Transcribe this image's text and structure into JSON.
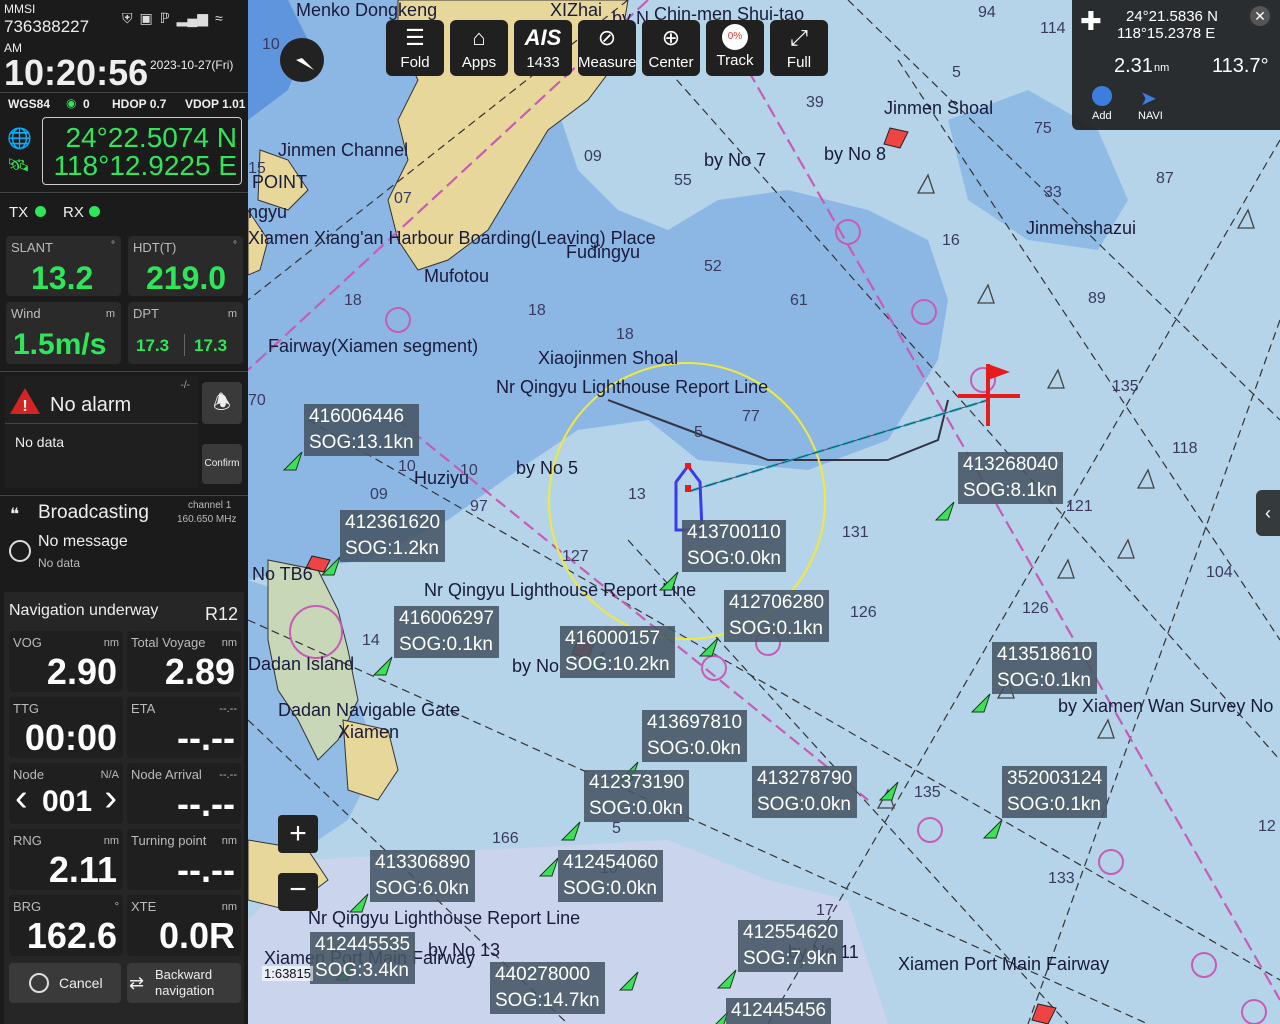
{
  "status": {
    "mmsi_label": "MMSI",
    "mmsi": "736388227",
    "ampm": "AM",
    "time": "10:20:56",
    "date": "2023-10-27(Fri)"
  },
  "gps": {
    "datum": "WGS84",
    "sats": "0",
    "hdop": "HDOP 0.7",
    "vdop": "VDOP 1.01",
    "lat": "24°22.5074 N",
    "lon": "118°12.9225 E"
  },
  "txrx": {
    "tx": "TX",
    "rx": "RX"
  },
  "gauges": [
    {
      "label": "SLANT",
      "unit": "°",
      "value": "13.2"
    },
    {
      "label": "HDT(T)",
      "unit": "°",
      "value": "219.0"
    },
    {
      "label": "Wind",
      "unit": "m",
      "value": "1.5m/s"
    },
    {
      "label": "DPT",
      "unit": "m",
      "value_a": "17.3",
      "value_b": "17.3"
    }
  ],
  "alarm": {
    "title": "No alarm",
    "flag": "-/-",
    "body": "No data",
    "confirm": "Confirm"
  },
  "broadcast": {
    "title": "Broadcasting",
    "channel": "channel 1",
    "freq": "160.650 MHz",
    "msg_title": "No message",
    "msg_body": "No data"
  },
  "nav": {
    "title": "Navigation underway",
    "route": "R12",
    "cells": [
      {
        "label": "VOG",
        "unit": "nm",
        "value": "2.90"
      },
      {
        "label": "Total Voyage",
        "unit": "nm",
        "value": "2.89"
      },
      {
        "label": "TTG",
        "unit": "",
        "value": "00:00"
      },
      {
        "label": "ETA",
        "unit": "--.--",
        "value": "--.--"
      },
      {
        "label": "Node",
        "unit": "N/A",
        "value": "001"
      },
      {
        "label": "Node Arrival",
        "unit": "--.--",
        "value": "--.--"
      },
      {
        "label": "RNG",
        "unit": "nm",
        "value": "2.11"
      },
      {
        "label": "Turning point",
        "unit": "nm",
        "value": "--.--"
      },
      {
        "label": "BRG",
        "unit": "°",
        "value": "162.6"
      },
      {
        "label": "XTE",
        "unit": "nm",
        "value": "0.0R"
      }
    ],
    "cancel": "Cancel",
    "backward": "Backward navigation"
  },
  "toolbar": [
    {
      "label": "Fold",
      "icon": "fold-icon"
    },
    {
      "label": "Apps",
      "icon": "home-icon"
    },
    {
      "label": "1433",
      "icon": "ais-icon",
      "icon_text": "AIS"
    },
    {
      "label": "Measure",
      "icon": "ruler-icon"
    },
    {
      "label": "Center",
      "icon": "crosshair-icon"
    },
    {
      "label": "Track",
      "icon": "track-icon",
      "icon_text": "0%"
    },
    {
      "label": "Full",
      "icon": "fullscreen-icon"
    }
  ],
  "cursor": {
    "lat": "24°21.5836 N",
    "lon": "118°15.2378 E",
    "dist": "2.31",
    "dist_unit": "nm",
    "bearing": "113.7°",
    "add": "Add",
    "navi": "NAVI"
  },
  "scale": "1:63815",
  "map_labels": [
    "Menko Dongkeng",
    "Chin-men Shui-tao",
    "Jinmen Shoal",
    "by No 7",
    "by No 8",
    "Jinmen Channel",
    "POINT",
    "Jinmenshazui",
    "Xiamen Xiang'an Harbour Boarding(Leaving) Place",
    "Fudingyu",
    "Mufotou",
    "Xiaojinmen Shoal",
    "Nr Qingyu Lighthouse Report Line",
    "Huziyu",
    "by No 5",
    "No TB6",
    "Dadan Island",
    "Dadan Navigable Gate",
    "Xiamen",
    "by Xiamen Wan Survey No",
    "Xiamen Port Main Fairway",
    "Nr Qingyu Lighthouse Report Line",
    "Nr Qingyu Lighthouse Report Line",
    "Fairway(Xiamen segment)",
    "Xiamen Port Main Fairway",
    "ngyu",
    "by No",
    "by No 11",
    "by No 13",
    "XIZhai",
    "by N"
  ],
  "ais": [
    {
      "mmsi": "416006446",
      "sog": "SOG:13.1kn"
    },
    {
      "mmsi": "412361620",
      "sog": "SOG:1.2kn"
    },
    {
      "mmsi": "413700110",
      "sog": "SOG:0.0kn"
    },
    {
      "mmsi": "413268040",
      "sog": "SOG:8.1kn"
    },
    {
      "mmsi": "412706280",
      "sog": "SOG:0.1kn"
    },
    {
      "mmsi": "416006297",
      "sog": "SOG:0.1kn"
    },
    {
      "mmsi": "416000157",
      "sog": "SOG:10.2kn"
    },
    {
      "mmsi": "413518610",
      "sog": "SOG:0.1kn"
    },
    {
      "mmsi": "413697810",
      "sog": "SOG:0.0kn"
    },
    {
      "mmsi": "412373190",
      "sog": "SOG:0.0kn"
    },
    {
      "mmsi": "413278790",
      "sog": "SOG:0.0kn"
    },
    {
      "mmsi": "352003124",
      "sog": "SOG:0.1kn"
    },
    {
      "mmsi": "413306890",
      "sog": "SOG:6.0kn"
    },
    {
      "mmsi": "412454060",
      "sog": "SOG:0.0kn"
    },
    {
      "mmsi": "412445535",
      "sog": "SOG:3.4kn"
    },
    {
      "mmsi": "412554620",
      "sog": "SOG:7.9kn"
    },
    {
      "mmsi": "440278000",
      "sog": "SOG:14.7kn"
    },
    {
      "mmsi": "412445456",
      "sog": ""
    }
  ],
  "depths": [
    "94",
    "114",
    "39",
    "75",
    "55",
    "09",
    "52",
    "61",
    "18",
    "18",
    "18",
    "77",
    "13",
    "127",
    "131",
    "104",
    "126",
    "126",
    "89",
    "87",
    "135",
    "118",
    "121",
    "33",
    "166",
    "133",
    "135",
    "10",
    "5",
    "5",
    "10",
    "10",
    "17",
    "12",
    "07",
    "70",
    "15",
    "5",
    "10",
    "97",
    "09",
    "16",
    "14"
  ],
  "colors": {
    "green": "#2ee65a",
    "land": "#e8d79a",
    "deep": "#b5d4ea",
    "shoal": "#5b95df",
    "route": "#c65db4"
  }
}
